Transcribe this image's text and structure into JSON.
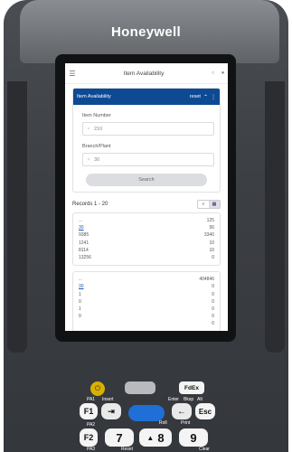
{
  "device": {
    "brand": "Honeywell"
  },
  "app": {
    "title": "Item Availability",
    "header_icons": [
      "menu-icon",
      "bell-icon",
      "user-icon"
    ]
  },
  "form_card": {
    "title": "Item Availability",
    "reset_label": "reset",
    "item_number": {
      "label": "Item Number",
      "value": "210"
    },
    "branch_plant": {
      "label": "Branch/Plant",
      "value": "30"
    },
    "search_label": "Search"
  },
  "records": {
    "label": "Records  1 - 20"
  },
  "list1": [
    {
      "key": "...",
      "value": "125",
      "link": false
    },
    {
      "key": "30",
      "value": "56",
      "link": true
    },
    {
      "key": "9385",
      "value": "3340",
      "link": false
    },
    {
      "key": "1241",
      "value": "10",
      "link": false
    },
    {
      "key": "8114",
      "value": "10",
      "link": false
    },
    {
      "key": "13256",
      "value": "0",
      "link": false
    }
  ],
  "list2": [
    {
      "key": "...",
      "value": "404846",
      "link": false
    },
    {
      "key": "30",
      "value": "0",
      "link": true
    },
    {
      "key": "1",
      "value": "0",
      "link": false
    },
    {
      "key": "0",
      "value": "0",
      "link": false
    },
    {
      "key": "1",
      "value": "0",
      "link": false
    },
    {
      "key": "0",
      "value": "0",
      "link": false
    },
    {
      "key": "",
      "value": "0",
      "link": false
    }
  ],
  "keypad": {
    "fedex": "FdEx",
    "f1": "F1",
    "f2": "F2",
    "esc": "Esc",
    "seven": "7",
    "eight": "8",
    "nine": "9",
    "labels": {
      "pa1": "PA1",
      "insert": "Insert",
      "enter": "Enter",
      "bksp": "Bksp",
      "alt": "Alt",
      "pa2": "PA2",
      "pa3": "PA3",
      "roll": "Roll",
      "print": "Print",
      "reset": "Reset",
      "clear": "Clear"
    }
  }
}
